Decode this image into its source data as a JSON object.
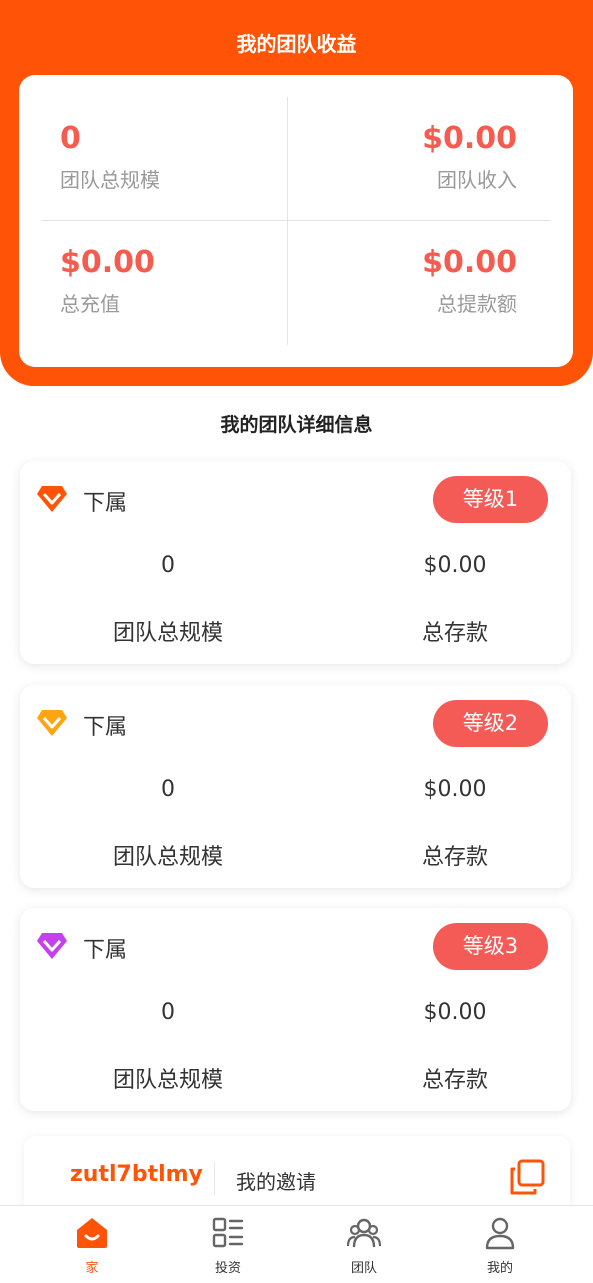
{
  "header": {
    "title": "我的团队收益"
  },
  "stats": {
    "team_size": {
      "value": "0",
      "label": "团队总规模"
    },
    "team_income": {
      "value": "$0.00",
      "label": "团队收入"
    },
    "total_recharge": {
      "value": "$0.00",
      "label": "总充值"
    },
    "total_withdraw": {
      "value": "$0.00",
      "label": "总提款额"
    }
  },
  "detail": {
    "title": "我的团队详细信息",
    "levels": [
      {
        "sub_label": "下属",
        "badge": "等级1",
        "team_size": "0",
        "team_size_label": "团队总规模",
        "deposit": "$0.00",
        "deposit_label": "总存款",
        "gem_color": "#ff5408"
      },
      {
        "sub_label": "下属",
        "badge": "等级2",
        "team_size": "0",
        "team_size_label": "团队总规模",
        "deposit": "$0.00",
        "deposit_label": "总存款",
        "gem_color": "#ffa514"
      },
      {
        "sub_label": "下属",
        "badge": "等级3",
        "team_size": "0",
        "team_size_label": "团队总规模",
        "deposit": "$0.00",
        "deposit_label": "总存款",
        "gem_color": "#c541f0"
      }
    ]
  },
  "invite": {
    "code": "zutl7btlmy",
    "label": "我的邀请",
    "icon": "copy-icon"
  },
  "tabbar": {
    "items": [
      {
        "label": "家",
        "icon": "home-icon",
        "active": true
      },
      {
        "label": "投资",
        "icon": "list-icon",
        "active": false
      },
      {
        "label": "团队",
        "icon": "team-icon",
        "active": false
      },
      {
        "label": "我的",
        "icon": "user-icon",
        "active": false
      }
    ]
  },
  "colors": {
    "accent": "#ff5408",
    "value_red": "#f55b4e",
    "badge_red": "#f55b56"
  }
}
